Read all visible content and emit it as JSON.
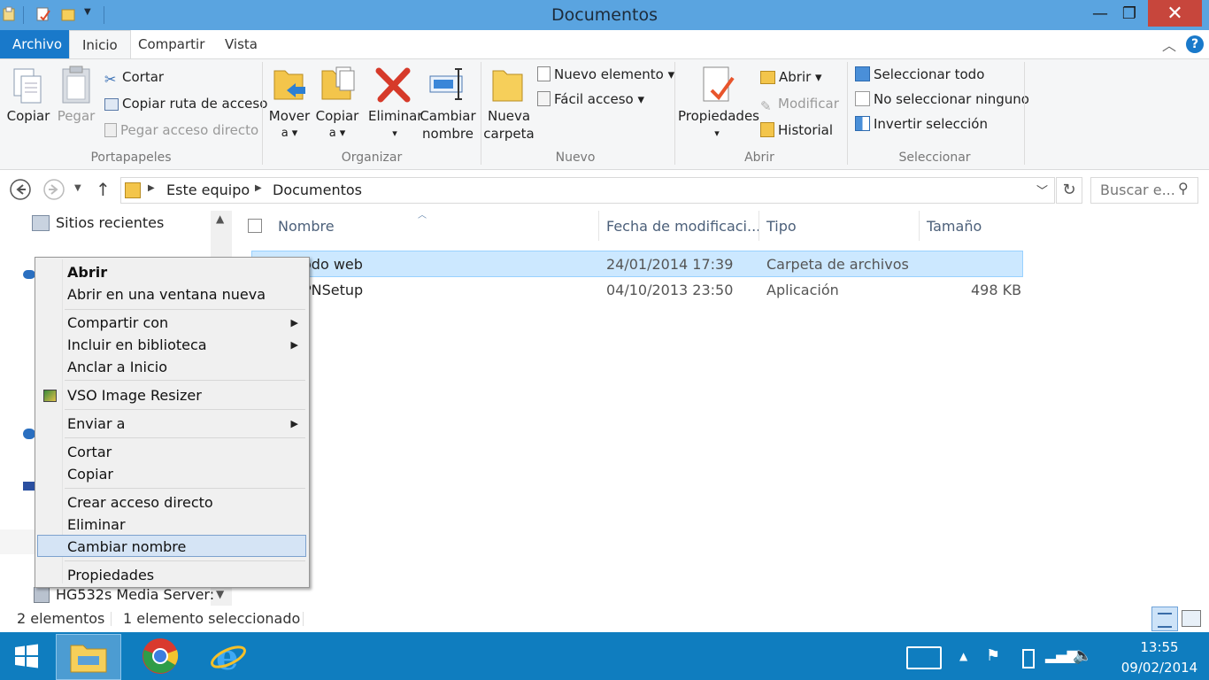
{
  "window": {
    "title": "Documentos"
  },
  "colors": {
    "titlebar": "#5aa4e0",
    "archivo_tab": "#1979ca",
    "close": "#c7463c",
    "taskbar": "#0f7dbf",
    "selection": "#cce8ff"
  },
  "ribbon": {
    "tabs": [
      "Archivo",
      "Inicio",
      "Compartir",
      "Vista"
    ],
    "portapapeles": {
      "label": "Portapapeles",
      "copiar": "Copiar",
      "pegar": "Pegar",
      "cortar": "Cortar",
      "copiar_ruta": "Copiar ruta de acceso",
      "pegar_acceso": "Pegar acceso directo"
    },
    "organizar": {
      "label": "Organizar",
      "mover": "Mover",
      "mover2": "a ▾",
      "copiar": "Copiar",
      "copiar2": "a ▾",
      "eliminar": "Eliminar",
      "eliminar2": "▾",
      "cambiar": "Cambiar",
      "cambiar2": "nombre"
    },
    "nuevo": {
      "label": "Nuevo",
      "nueva": "Nueva",
      "carpeta": "carpeta",
      "nuevo_elemento": "Nuevo elemento ▾",
      "facil_acceso": "Fácil acceso ▾"
    },
    "abrir": {
      "label": "Abrir",
      "propiedades": "Propiedades",
      "propiedades2": "▾",
      "abrir": "Abrir ▾",
      "modificar": "Modificar",
      "historial": "Historial"
    },
    "seleccionar": {
      "label": "Seleccionar",
      "todo": "Seleccionar todo",
      "ninguno": "No seleccionar ninguno",
      "invertir": "Invertir selección"
    }
  },
  "address": {
    "crumbs": [
      "Este equipo",
      "Documentos"
    ],
    "search_placeholder": "Buscar e..."
  },
  "nav": {
    "recent": "Sitios recientes",
    "media": "HG532s Media Server:"
  },
  "columns": {
    "name": "Nombre",
    "date": "Fecha de modificaci...",
    "type": "Tipo",
    "size": "Tamaño"
  },
  "files": [
    {
      "name": "odo web",
      "date": "24/01/2014 17:39",
      "type": "Carpeta de archivos",
      "size": ""
    },
    {
      "name": "PNSetup",
      "date": "04/10/2013 23:50",
      "type": "Aplicación",
      "size": "498 KB"
    }
  ],
  "context_menu": {
    "abrir": "Abrir",
    "abrir_nueva": "Abrir en una ventana nueva",
    "compartir": "Compartir con",
    "incluir": "Incluir en biblioteca",
    "anclar": "Anclar a Inicio",
    "vso": "VSO Image Resizer",
    "enviar": "Enviar a",
    "cortar": "Cortar",
    "copiar": "Copiar",
    "crear_acceso": "Crear acceso directo",
    "eliminar": "Eliminar",
    "cambiar_nombre": "Cambiar nombre",
    "propiedades": "Propiedades"
  },
  "status": {
    "count": "2 elementos",
    "selected": "1 elemento seleccionado"
  },
  "taskbar": {
    "time": "13:55",
    "date": "09/02/2014"
  }
}
